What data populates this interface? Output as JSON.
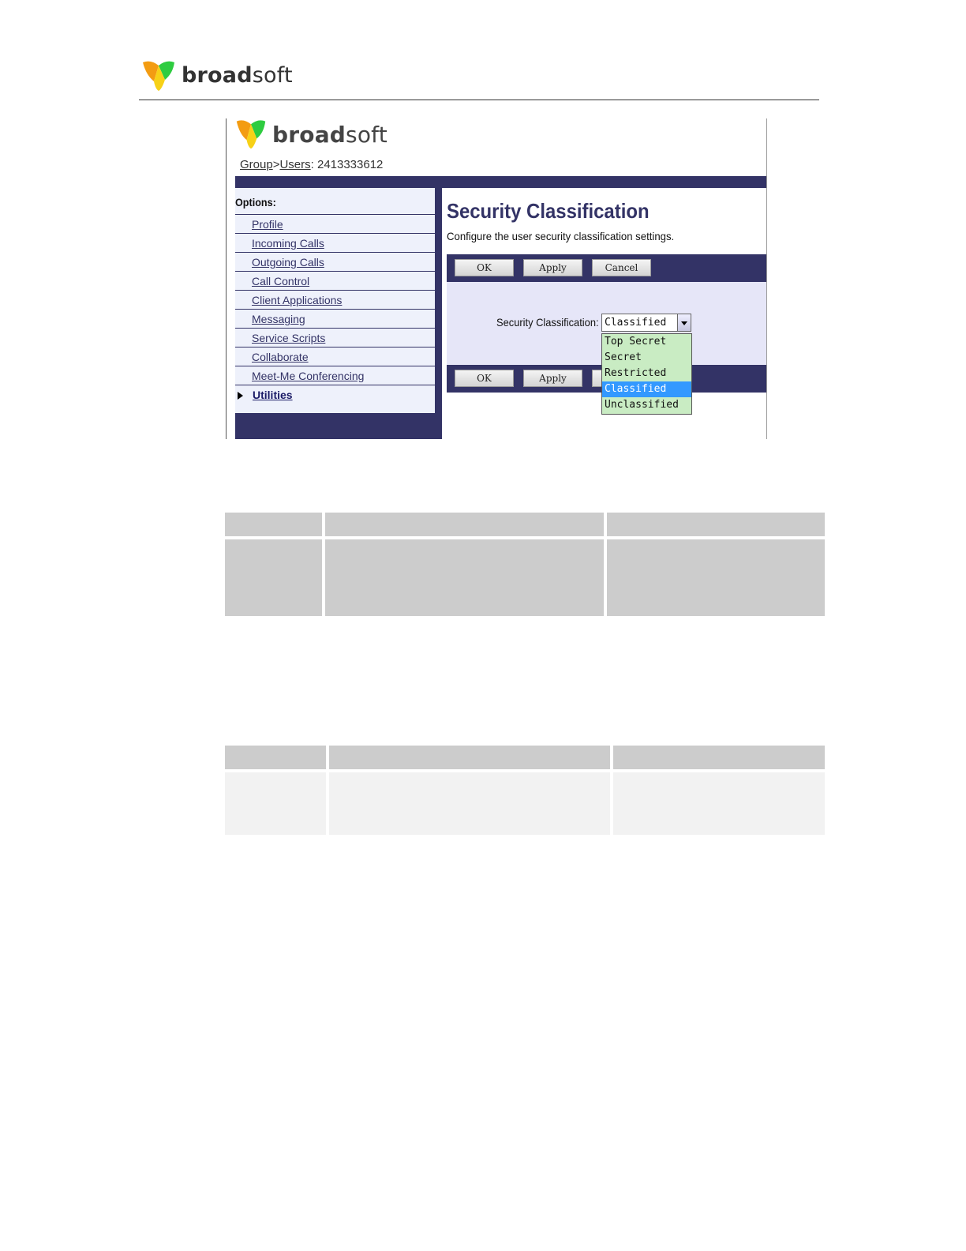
{
  "page_header": {
    "brand": {
      "bold": "broad",
      "light": "soft"
    }
  },
  "screenshot": {
    "brand": {
      "bold": "broad",
      "light": "soft"
    },
    "breadcrumb": {
      "group": "Group",
      "sep": ">",
      "users": "Users",
      "user_id": ": 2413333612"
    },
    "options_label": "Options:",
    "nav_items": [
      "Profile",
      "Incoming Calls",
      "Outgoing Calls",
      "Call Control",
      "Client Applications",
      "Messaging",
      "Service Scripts",
      "Collaborate",
      "Meet-Me Conferencing"
    ],
    "utilities_label": "Utilities",
    "title": "Security Classification",
    "description": "Configure the user security classification settings.",
    "buttons": {
      "ok": "OK",
      "apply": "Apply",
      "cancel": "Cancel"
    },
    "field_label": "Security Classification:",
    "selected_value": "Classified",
    "options": [
      "Top Secret",
      "Secret",
      "Restricted",
      "Classified",
      "Unclassified"
    ],
    "highlighted_option": "Classified"
  },
  "colors": {
    "header_bar": "#333366",
    "form_bg": "#e6e6f8",
    "dropdown_bg": "#c9ecc3",
    "highlight": "#3399ff",
    "table_dark": "#cccccc",
    "table_light": "#f2f2f2"
  }
}
